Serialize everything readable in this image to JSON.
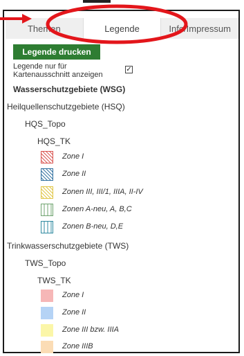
{
  "tabs": [
    {
      "label": "Themen"
    },
    {
      "label": "Legende"
    },
    {
      "label": "Info/Impressum"
    }
  ],
  "print_button": {
    "label": "Legende drucken"
  },
  "map_extent_option": {
    "label_line1": "Legende nur für",
    "label_line2": "Kartenausschnitt anzeigen",
    "checked": true,
    "check_glyph": "✓"
  },
  "section_title": "Wasserschutzgebiete (WSG)",
  "hsq": {
    "group_title": "Heilquellenschutzgebiete (HSQ)",
    "sub_title": "HQS_Topo",
    "layer_title": "HQS_TK",
    "items": [
      {
        "label": "Zone I",
        "color": "#d9534f",
        "pattern": "hatch"
      },
      {
        "label": "Zone II",
        "color": "#2f6f9f",
        "pattern": "hatch"
      },
      {
        "label": "Zonen III, III/1, IIIA, II-IV",
        "color": "#e0c542",
        "pattern": "hatch"
      },
      {
        "label": "Zonen A-neu, A, B,C",
        "color": "#6fa36f",
        "pattern": "vertical"
      },
      {
        "label": "Zonen B-neu, D,E",
        "color": "#2f8aa0",
        "pattern": "vertical"
      }
    ]
  },
  "tws": {
    "group_title": "Trinkwasserschutzgebiete (TWS)",
    "sub_title": "TWS_Topo",
    "layer_title": "TWS_TK",
    "items": [
      {
        "label": "Zone I",
        "color": "#f6b7b7"
      },
      {
        "label": "Zone II",
        "color": "#b5d3f5"
      },
      {
        "label": "Zone III bzw. IIIA",
        "color": "#fbf6a8"
      },
      {
        "label": "Zone IIIB",
        "color": "#fbdcb5"
      }
    ]
  },
  "annotation": {
    "color": "#e3161b"
  }
}
